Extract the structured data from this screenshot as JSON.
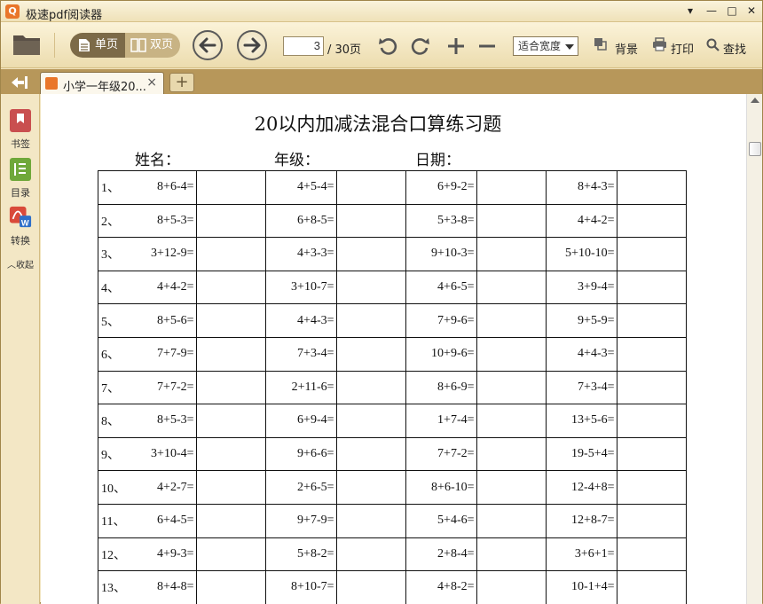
{
  "window": {
    "title": "极速pdf阅读器",
    "logo_letter": "Q",
    "min": "▾",
    "restore": "—",
    "max": "□",
    "close": "✕"
  },
  "toolbar": {
    "single_page": "单页",
    "double_page": "双页",
    "current_page": "3",
    "total_pages": "/ 30页",
    "zoom_mode": "适合宽度",
    "background": "背景",
    "print": "打印",
    "search": "查找"
  },
  "tabs": {
    "active": "小学一年级20...",
    "close": "×",
    "new": "+"
  },
  "sidebar": {
    "items": [
      {
        "label": "书签",
        "color": "#c94f4f"
      },
      {
        "label": "目录",
        "color": "#6fa83a"
      },
      {
        "label": "转换",
        "color": "#d94a3a"
      }
    ],
    "collapse": "︿收起"
  },
  "document": {
    "title": "20以内加减法混合口算练习题",
    "name_label": "姓名：",
    "grade_label": "年级：",
    "date_label": "日期：",
    "rows": [
      {
        "n": "1、",
        "q": [
          "8+6-4=",
          "4+5-4=",
          "6+9-2=",
          "8+4-3="
        ]
      },
      {
        "n": "2、",
        "q": [
          "8+5-3=",
          "6+8-5=",
          "5+3-8=",
          "4+4-2="
        ]
      },
      {
        "n": "3、",
        "q": [
          "3+12-9=",
          "4+3-3=",
          "9+10-3=",
          "5+10-10="
        ]
      },
      {
        "n": "4、",
        "q": [
          "4+4-2=",
          "3+10-7=",
          "4+6-5=",
          "3+9-4="
        ]
      },
      {
        "n": "5、",
        "q": [
          "8+5-6=",
          "4+4-3=",
          "7+9-6=",
          "9+5-9="
        ]
      },
      {
        "n": "6、",
        "q": [
          "7+7-9=",
          "7+3-4=",
          "10+9-6=",
          "4+4-3="
        ]
      },
      {
        "n": "7、",
        "q": [
          "7+7-2=",
          "2+11-6=",
          "8+6-9=",
          "7+3-4="
        ]
      },
      {
        "n": "8、",
        "q": [
          "8+5-3=",
          "6+9-4=",
          "1+7-4=",
          "13+5-6="
        ]
      },
      {
        "n": "9、",
        "q": [
          "3+10-4=",
          "9+6-6=",
          "7+7-2=",
          "19-5+4="
        ]
      },
      {
        "n": "10、",
        "q": [
          "4+2-7=",
          "2+6-5=",
          "8+6-10=",
          "12-4+8="
        ]
      },
      {
        "n": "11、",
        "q": [
          "6+4-5=",
          "9+7-9=",
          "5+4-6=",
          "12+8-7="
        ]
      },
      {
        "n": "12、",
        "q": [
          "4+9-3=",
          "5+8-2=",
          "2+8-4=",
          "3+6+1="
        ]
      },
      {
        "n": "13、",
        "q": [
          "8+4-8=",
          "8+10-7=",
          "4+8-2=",
          "10-1+4="
        ]
      }
    ]
  }
}
